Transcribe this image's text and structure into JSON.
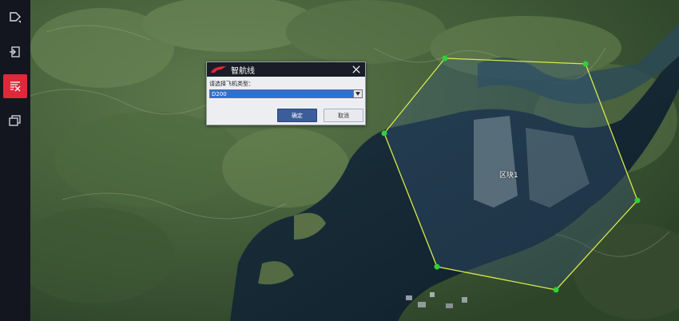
{
  "toolbar": {
    "tools": [
      {
        "name": "select-tool",
        "icon": "select-arrow-icon",
        "active": false
      },
      {
        "name": "import-tool",
        "icon": "import-icon",
        "active": false
      },
      {
        "name": "route-tool",
        "icon": "route-edit-icon",
        "active": true
      },
      {
        "name": "layers-tool",
        "icon": "layers-icon",
        "active": false
      }
    ]
  },
  "dialog": {
    "title": "智航线",
    "prompt": "请选择飞机类型：",
    "selected_aircraft": "D200",
    "ok_label": "确定",
    "cancel_label": "取消"
  },
  "map": {
    "polygon_label": "区块1",
    "polygon_color": "#d8e84a",
    "vertex_color": "#2fd13a"
  },
  "colors": {
    "accent": "#e0283a",
    "select_highlight": "#2d6fd6",
    "ok_button": "#3b5d9a"
  }
}
